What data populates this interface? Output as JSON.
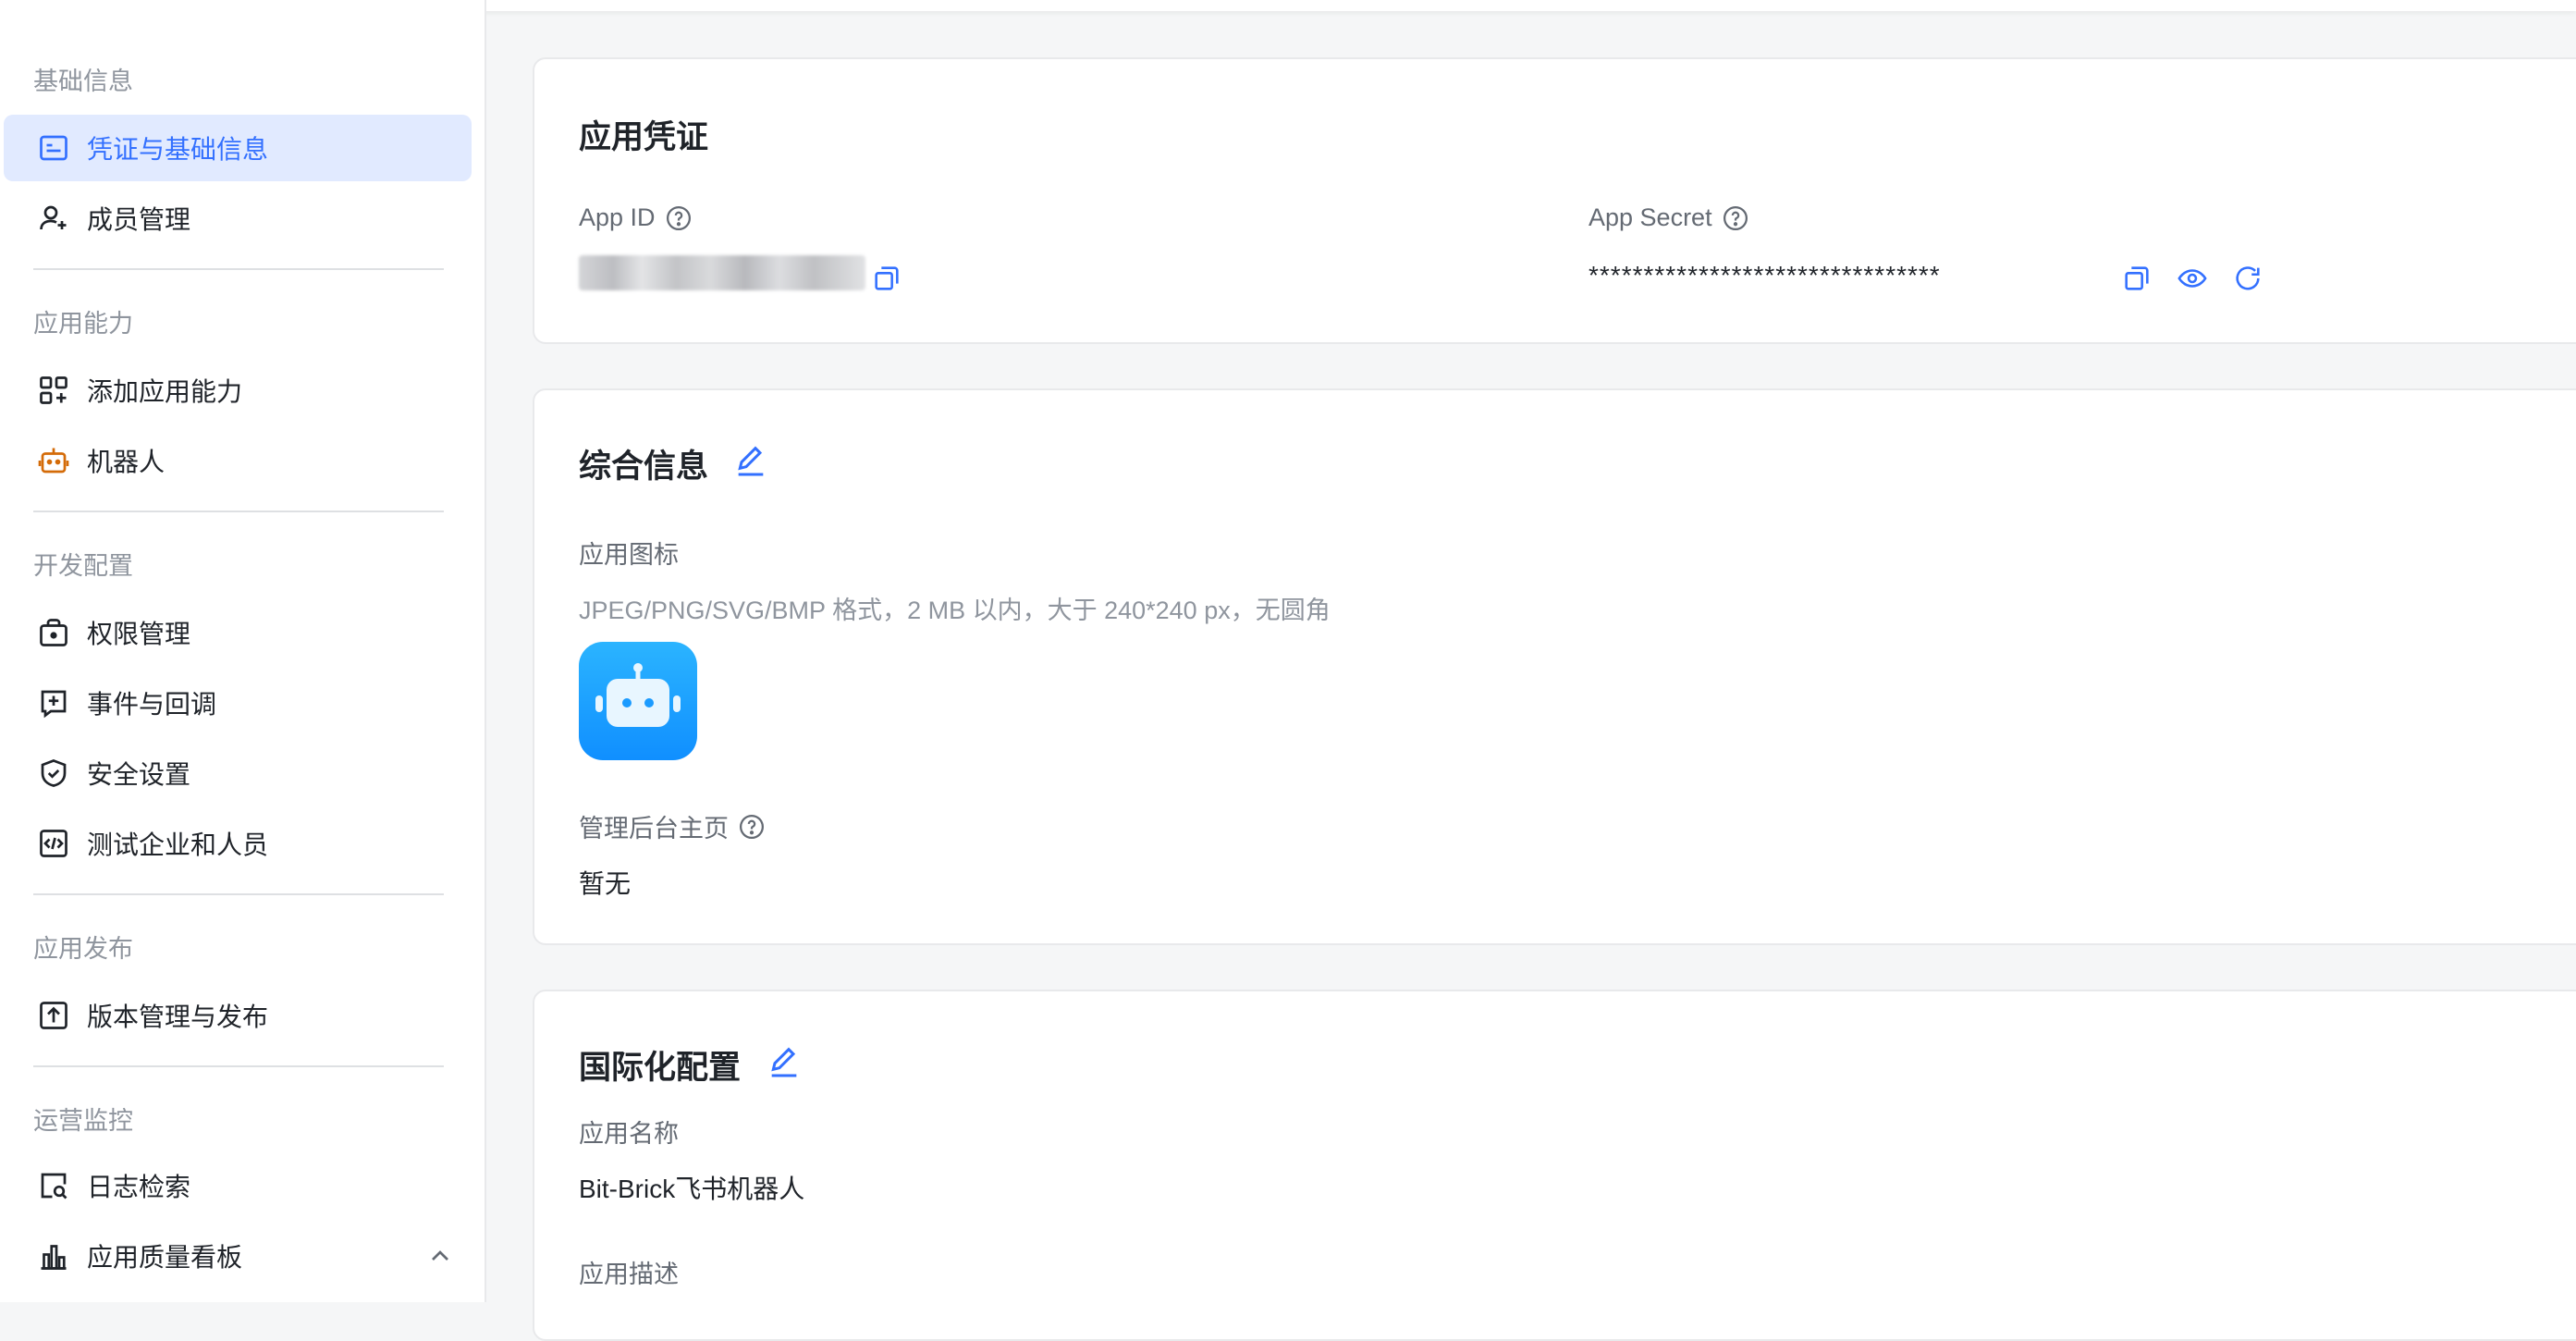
{
  "sidebar": {
    "sections": [
      {
        "title": "基础信息",
        "items": [
          {
            "label": "凭证与基础信息",
            "icon": "credential-icon",
            "active": true
          },
          {
            "label": "成员管理",
            "icon": "add-user-icon"
          }
        ]
      },
      {
        "title": "应用能力",
        "items": [
          {
            "label": "添加应用能力",
            "icon": "add-apps-icon"
          },
          {
            "label": "机器人",
            "icon": "robot-icon"
          }
        ]
      },
      {
        "title": "开发配置",
        "items": [
          {
            "label": "权限管理",
            "icon": "permission-bag-icon"
          },
          {
            "label": "事件与回调",
            "icon": "event-plus-icon"
          },
          {
            "label": "安全设置",
            "icon": "shield-check-icon"
          },
          {
            "label": "测试企业和人员",
            "icon": "code-box-icon"
          }
        ]
      },
      {
        "title": "应用发布",
        "items": [
          {
            "label": "版本管理与发布",
            "icon": "upload-box-icon"
          }
        ]
      },
      {
        "title": "运营监控",
        "items": [
          {
            "label": "日志检索",
            "icon": "log-search-icon"
          },
          {
            "label": "应用质量看板",
            "icon": "bar-chart-icon",
            "expanded": true
          }
        ]
      }
    ]
  },
  "credentials": {
    "title": "应用凭证",
    "app_id_label": "App ID",
    "app_secret_label": "App Secret",
    "app_secret_value": "********************************"
  },
  "general": {
    "title": "综合信息",
    "icon_label": "应用图标",
    "icon_hint": "JPEG/PNG/SVG/BMP 格式，2 MB 以内，大于 240*240 px，无圆角",
    "admin_home_label": "管理后台主页",
    "admin_home_value": "暂无"
  },
  "i18n": {
    "title": "国际化配置",
    "name_label": "应用名称",
    "name_value": "Bit-Brick飞书机器人",
    "desc_label": "应用描述"
  },
  "colors": {
    "accent": "#3370ff",
    "active_bg": "#e1eaff",
    "robot_orange": "#d46b08"
  }
}
